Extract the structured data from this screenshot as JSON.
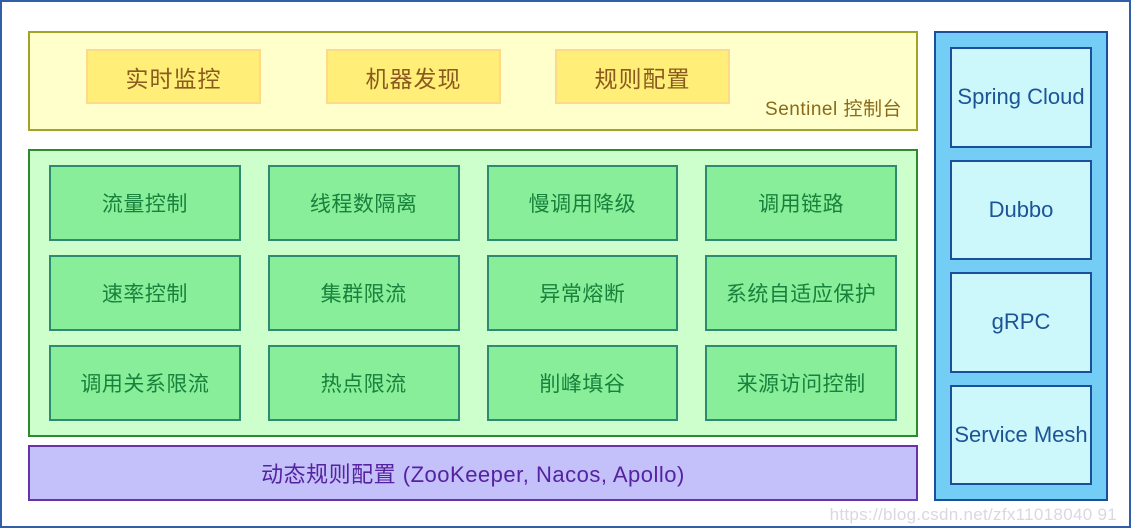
{
  "console": {
    "label": "Sentinel 控制台",
    "buttons": [
      {
        "label": "实时监控"
      },
      {
        "label": "机器发现"
      },
      {
        "label": "规则配置"
      }
    ]
  },
  "features": {
    "cells": [
      {
        "label": "流量控制"
      },
      {
        "label": "线程数隔离"
      },
      {
        "label": "慢调用降级"
      },
      {
        "label": "调用链路"
      },
      {
        "label": "速率控制"
      },
      {
        "label": "集群限流"
      },
      {
        "label": "异常熔断"
      },
      {
        "label": "系统自适应保护"
      },
      {
        "label": "调用关系限流"
      },
      {
        "label": "热点限流"
      },
      {
        "label": "削峰填谷"
      },
      {
        "label": "来源访问控制"
      }
    ]
  },
  "rules": {
    "label": "动态规则配置 (ZooKeeper, Nacos, Apollo)"
  },
  "integrations": {
    "cells": [
      {
        "label": "Spring Cloud"
      },
      {
        "label": "Dubbo"
      },
      {
        "label": "gRPC"
      },
      {
        "label": "Service Mesh"
      }
    ]
  },
  "watermark": {
    "text": "https://blog.csdn.net/zfx11018040 91"
  },
  "colors": {
    "console_panel_bg": "#ffffcc",
    "console_panel_border": "#a3a329",
    "console_btn_bg": "#ffee77",
    "console_btn_border": "#ffd98a",
    "console_text": "#8a5a1e",
    "feature_panel_bg": "#ccffcc",
    "feature_panel_border": "#2d8a2d",
    "feature_cell_bg": "#88ee99",
    "feature_cell_border": "#2e8b72",
    "feature_text": "#18823c",
    "rules_bg": "#c3c0fa",
    "rules_border": "#6633aa",
    "rules_text": "#5522a0",
    "integration_panel_bg": "#73cdf5",
    "integration_cell_bg": "#ccf7fb",
    "integration_border": "#1b4f9c",
    "integration_text": "#1d5496",
    "canvas_border": "#2f5fa8"
  }
}
